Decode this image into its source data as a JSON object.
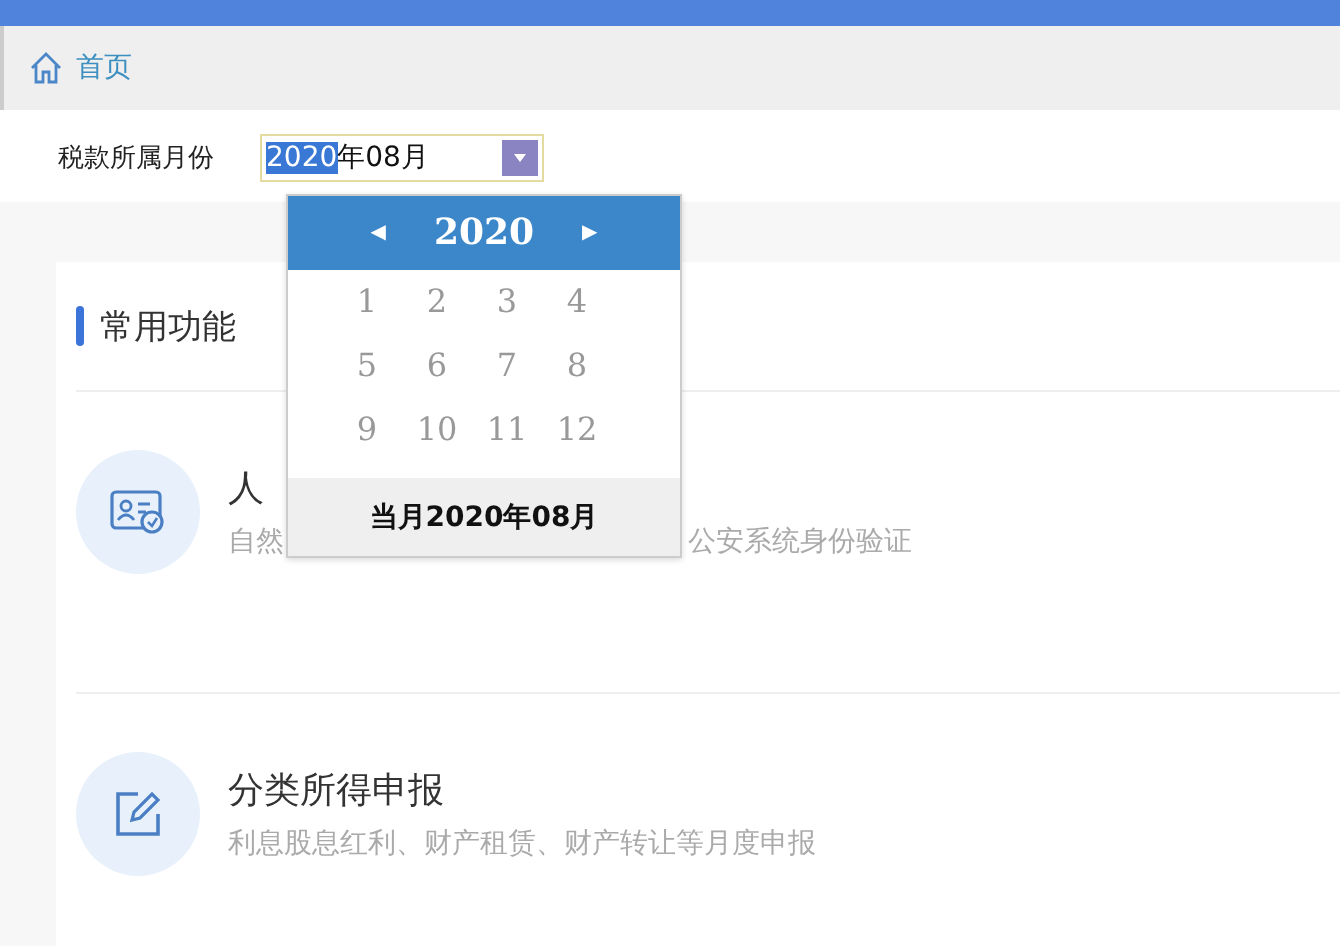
{
  "breadcrumb": {
    "label": "首页"
  },
  "filter": {
    "label": "税款所属月份",
    "value_selected": "2020",
    "value_rest": "年08月"
  },
  "picker": {
    "prev": "◀",
    "year": "2020",
    "next": "▶",
    "months": [
      {
        "label": "1",
        "selected": false
      },
      {
        "label": "2",
        "selected": false
      },
      {
        "label": "3",
        "selected": false
      },
      {
        "label": "4",
        "selected": false
      },
      {
        "label": "5",
        "selected": false
      },
      {
        "label": "6",
        "selected": false
      },
      {
        "label": "7",
        "selected": false
      },
      {
        "label": "8",
        "selected": false
      },
      {
        "label": "9",
        "selected": false
      },
      {
        "label": "10",
        "selected": false
      },
      {
        "label": "11",
        "selected": false
      },
      {
        "label": "12",
        "selected": false
      }
    ],
    "current": "当月2020年08月"
  },
  "section": {
    "title": "常用功能"
  },
  "functions": [
    {
      "kind": "id",
      "title": "人",
      "desc_start": "自然",
      "desc_end": "公安系统身份验证"
    },
    {
      "kind": "edit",
      "title": "分类所得申报",
      "desc_start": "利息股息红利、财产租赁、财产转让等月度申报"
    }
  ]
}
